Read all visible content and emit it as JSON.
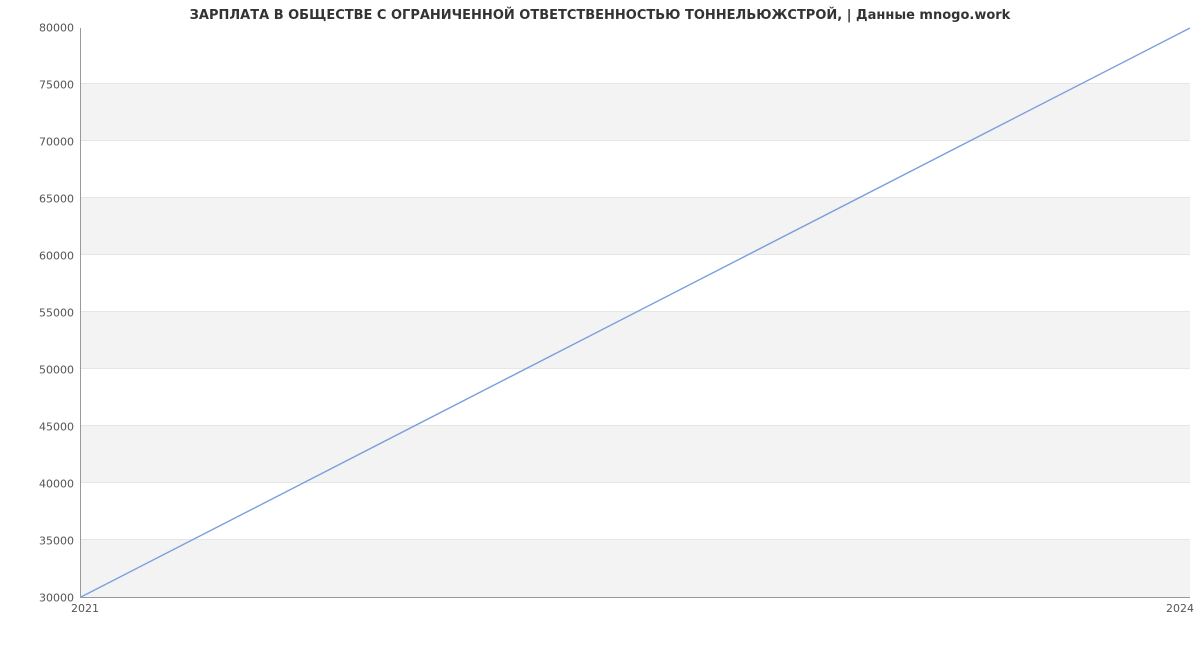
{
  "chart_data": {
    "type": "line",
    "title": "ЗАРПЛАТА В ОБЩЕСТВЕ С ОГРАНИЧЕННОЙ ОТВЕТСТВЕННОСТЬЮ ТОННЕЛЬЮЖСТРОЙ, | Данные mnogo.work",
    "x": [
      2021,
      2024
    ],
    "values": [
      30000,
      80000
    ],
    "xlim": [
      2021,
      2024
    ],
    "ylim": [
      30000,
      80000
    ],
    "yticks": [
      30000,
      35000,
      40000,
      45000,
      50000,
      55000,
      60000,
      65000,
      70000,
      75000,
      80000
    ],
    "xticks": [
      2021,
      2024
    ],
    "xlabel": "",
    "ylabel": "",
    "line_color": "#7a9ede",
    "grid": true
  }
}
